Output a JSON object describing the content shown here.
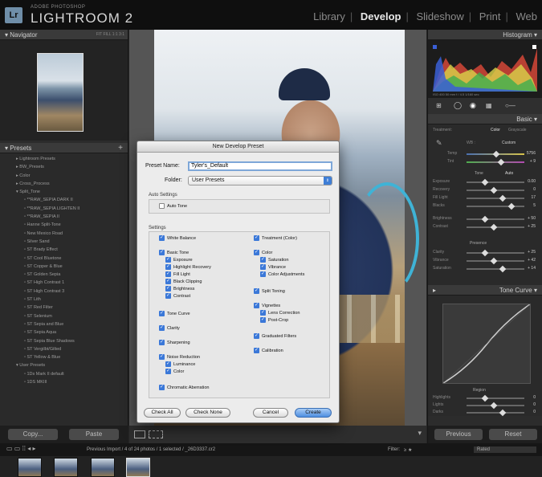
{
  "app": {
    "brand_small": "ADOBE PHOTOSHOP",
    "brand_big": "LIGHTROOM 2",
    "logo": "Lr",
    "modules": [
      "Library",
      "Develop",
      "Slideshow",
      "Print",
      "Web"
    ],
    "active_module": "Develop"
  },
  "left": {
    "navigator_label": "Navigator",
    "navigator_opts": "FIT  FILL  1:1  3:1",
    "presets_label": "Presets",
    "presets": [
      {
        "label": "Lightroom Presets",
        "level": 1,
        "arrow": "▸"
      },
      {
        "label": "BW_Presets",
        "level": 1,
        "arrow": "▸"
      },
      {
        "label": "Color",
        "level": 1,
        "arrow": "▸"
      },
      {
        "label": "Cross_Process",
        "level": 1,
        "arrow": "▸"
      },
      {
        "label": "Split_Tone",
        "level": 1,
        "arrow": "▾"
      },
      {
        "label": "**RAW_SEPIA DARK II",
        "level": 2
      },
      {
        "label": "**RAW_SEPIA LIGHTEN II",
        "level": 2
      },
      {
        "label": "**RAW_SEPIA II",
        "level": 2
      },
      {
        "label": "Hanne Split-Tone",
        "level": 2
      },
      {
        "label": "New Mexico Road",
        "level": 2
      },
      {
        "label": "Silver Sand",
        "level": 2
      },
      {
        "label": "ST Brady Effect",
        "level": 2
      },
      {
        "label": "ST Cool Bluetone",
        "level": 2
      },
      {
        "label": "ST Copper & Blue",
        "level": 2
      },
      {
        "label": "ST Golden Sepia",
        "level": 2
      },
      {
        "label": "ST High Contrast 1",
        "level": 2
      },
      {
        "label": "ST High Contrast 3",
        "level": 2
      },
      {
        "label": "ST Lith",
        "level": 2
      },
      {
        "label": "ST Red Filter",
        "level": 2
      },
      {
        "label": "ST Selenium",
        "level": 2
      },
      {
        "label": "ST Sepia and Blue",
        "level": 2
      },
      {
        "label": "ST Sepia Aqua",
        "level": 2
      },
      {
        "label": "ST Sepia Blue Shadows",
        "level": 2
      },
      {
        "label": "ST Vergilbt/Gilted",
        "level": 2
      },
      {
        "label": "ST Yellow & Blue",
        "level": 2
      },
      {
        "label": "User Presets",
        "level": 1,
        "arrow": "▾"
      },
      {
        "label": "1Ds Mark II default",
        "level": 2
      },
      {
        "label": "1DS MKIII",
        "level": 2
      }
    ],
    "copy_btn": "Copy...",
    "paste_btn": "Paste"
  },
  "right": {
    "histogram_label": "Histogram",
    "histo_info": "ISO 400     50 mm     f / 4.5     1/160 sec",
    "basic_label": "Basic",
    "treatment": "Treatment:",
    "treatment_color": "Color",
    "treatment_gray": "Grayscale",
    "wb_label": "WB :",
    "wb_value": "Custom",
    "temp_label": "Temp",
    "temp_value": "5756",
    "tint_label": "Tint",
    "tint_value": "+ 9",
    "tone_label": "Tone",
    "auto_label": "Auto",
    "rows": [
      {
        "label": "Exposure",
        "value": "0.00"
      },
      {
        "label": "Recovery",
        "value": "0"
      },
      {
        "label": "Fill Light",
        "value": "17"
      },
      {
        "label": "Blacks",
        "value": "5"
      }
    ],
    "rows2": [
      {
        "label": "Brightness",
        "value": "+ 50"
      },
      {
        "label": "Contrast",
        "value": "+ 25"
      }
    ],
    "presence_label": "Presence",
    "rows3": [
      {
        "label": "Clarity",
        "value": "+ 25"
      },
      {
        "label": "Vibrance",
        "value": "+ 42"
      },
      {
        "label": "Saturation",
        "value": "+ 14"
      }
    ],
    "tone_curve_label": "Tone Curve",
    "region_label": "Region",
    "region_rows": [
      {
        "label": "Highlights",
        "value": "0"
      },
      {
        "label": "Lights",
        "value": "0"
      },
      {
        "label": "Darks",
        "value": "0"
      }
    ],
    "previous_btn": "Previous",
    "reset_btn": "Reset"
  },
  "filmbar": {
    "info": "Previous Import / 4 of 24 photos / 1 selected / _26D3337.cr2",
    "filter_label": "Filter:",
    "filter_value": "≥ ★",
    "rated": "Rated"
  },
  "dialog": {
    "title": "New Develop Preset",
    "preset_name_label": "Preset Name:",
    "preset_name_value": "Tyler's_Default",
    "folder_label": "Folder:",
    "folder_value": "User Presets",
    "auto_settings_label": "Auto Settings",
    "auto_tone": "Auto Tone",
    "settings_label": "Settings",
    "left_col": [
      {
        "label": "White Balance",
        "checked": true,
        "indent": 0
      },
      {
        "label": "Basic Tone",
        "checked": true,
        "indent": 0
      },
      {
        "label": "Exposure",
        "checked": true,
        "indent": 1
      },
      {
        "label": "Highlight Recovery",
        "checked": true,
        "indent": 1
      },
      {
        "label": "Fill Light",
        "checked": true,
        "indent": 1
      },
      {
        "label": "Black Clipping",
        "checked": true,
        "indent": 1
      },
      {
        "label": "Brightness",
        "checked": true,
        "indent": 1
      },
      {
        "label": "Contrast",
        "checked": true,
        "indent": 1
      },
      {
        "label": "Tone Curve",
        "checked": true,
        "indent": 0
      },
      {
        "label": "Clarity",
        "checked": true,
        "indent": 0
      },
      {
        "label": "Sharpening",
        "checked": true,
        "indent": 0
      },
      {
        "label": "Noise Reduction",
        "checked": true,
        "indent": 0
      },
      {
        "label": "Luminance",
        "checked": true,
        "indent": 1
      },
      {
        "label": "Color",
        "checked": true,
        "indent": 1
      },
      {
        "label": "Chromatic Aberration",
        "checked": true,
        "indent": 0
      }
    ],
    "right_col": [
      {
        "label": "Treatment (Color)",
        "checked": true,
        "indent": 0
      },
      {
        "label": "Color",
        "checked": true,
        "indent": 0
      },
      {
        "label": "Saturation",
        "checked": true,
        "indent": 1
      },
      {
        "label": "Vibrance",
        "checked": true,
        "indent": 1
      },
      {
        "label": "Color Adjustments",
        "checked": true,
        "indent": 1
      },
      {
        "label": "Split Toning",
        "checked": true,
        "indent": 0
      },
      {
        "label": "Vignettes",
        "checked": true,
        "indent": 0
      },
      {
        "label": "Lens Correction",
        "checked": true,
        "indent": 1
      },
      {
        "label": "Post-Crop",
        "checked": true,
        "indent": 1
      },
      {
        "label": "Graduated Filters",
        "checked": true,
        "indent": 0
      },
      {
        "label": "Calibration",
        "checked": true,
        "indent": 0
      }
    ],
    "check_all": "Check All",
    "check_none": "Check None",
    "cancel": "Cancel",
    "create": "Create"
  }
}
